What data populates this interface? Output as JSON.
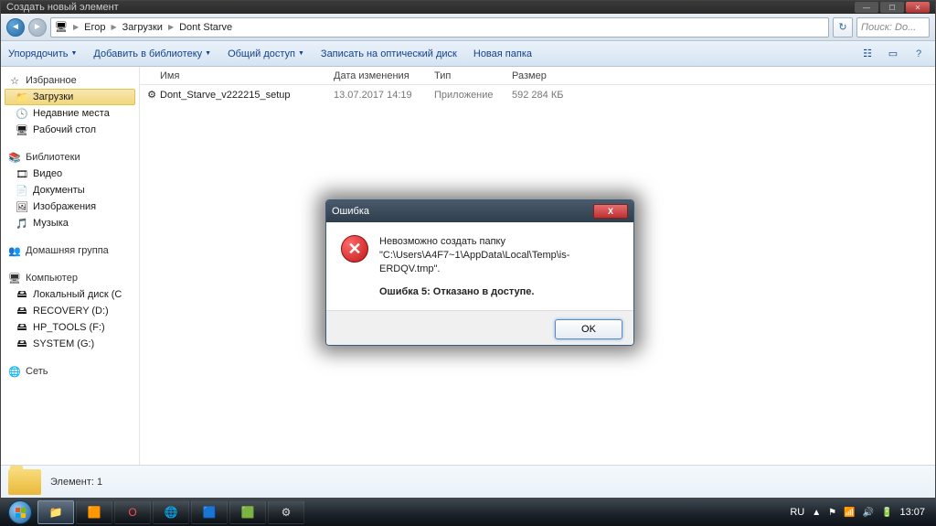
{
  "window": {
    "tab_title": "Создать новый элемент"
  },
  "breadcrumbs": [
    "Егор",
    "Загрузки",
    "Dont Starve"
  ],
  "search_placeholder": "Поиск: Do...",
  "toolbar": {
    "organize": "Упорядочить",
    "include": "Добавить в библиотеку",
    "share": "Общий доступ",
    "burn": "Записать на оптический диск",
    "newfolder": "Новая папка"
  },
  "columns": {
    "name": "Имя",
    "date": "Дата изменения",
    "type": "Тип",
    "size": "Размер"
  },
  "files": [
    {
      "name": "Dont_Starve_v222215_setup",
      "date": "13.07.2017 14:19",
      "type": "Приложение",
      "size": "592 284 КБ"
    }
  ],
  "sidebar": {
    "favorites": {
      "title": "Избранное",
      "downloads": "Загрузки",
      "recent": "Недавние места",
      "desktop": "Рабочий стол"
    },
    "libraries": {
      "title": "Библиотеки",
      "video": "Видео",
      "documents": "Документы",
      "pictures": "Изображения",
      "music": "Музыка"
    },
    "homegroup": "Домашняя группа",
    "computer": {
      "title": "Компьютер",
      "local": "Локальный диск (C",
      "recovery": "RECOVERY (D:)",
      "hptools": "HP_TOOLS (F:)",
      "system": "SYSTEM (G:)"
    },
    "network": "Сеть"
  },
  "details": {
    "count_label": "Элемент: 1"
  },
  "dialog": {
    "title": "Ошибка",
    "line1": "Невозможно создать папку",
    "line2": "\"C:\\Users\\A4F7~1\\AppData\\Local\\Temp\\is-ERDQV.tmp\".",
    "line3": "Ошибка 5: Отказано в доступе.",
    "ok": "OK"
  },
  "tray": {
    "lang": "RU",
    "time": "13:07"
  }
}
